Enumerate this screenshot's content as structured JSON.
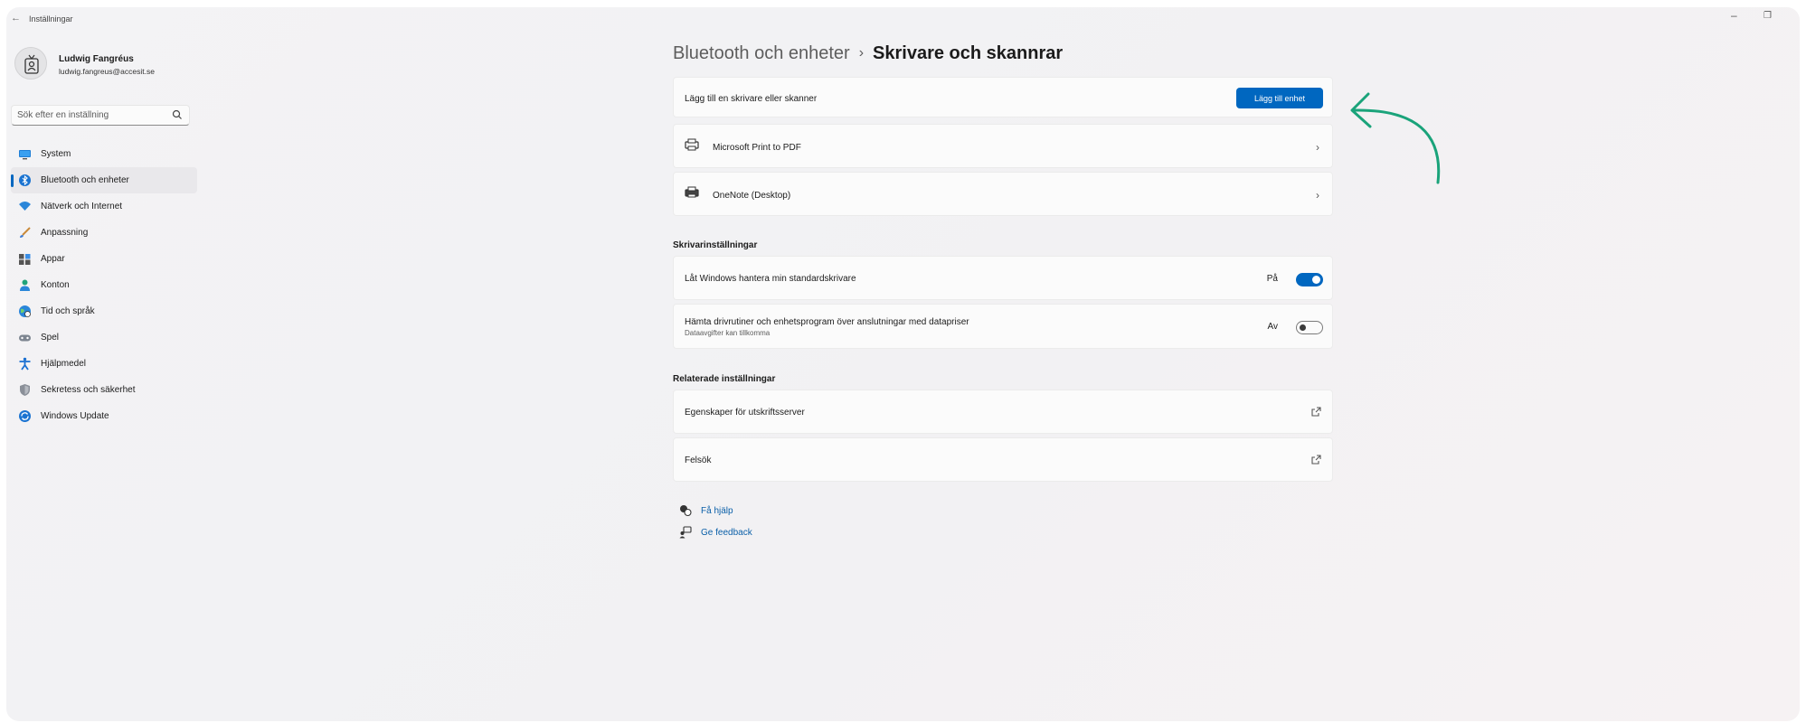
{
  "window": {
    "title": "Inställningar",
    "back_glyph": "←",
    "minimize_glyph": "–",
    "restore_glyph": "❐"
  },
  "profile": {
    "name": "Ludwig Fangréus",
    "email": "ludwig.fangreus@accesit.se"
  },
  "search": {
    "placeholder": "Sök efter en inställning"
  },
  "sidebar": {
    "items": [
      {
        "label": "System",
        "icon": "monitor-icon",
        "active": false
      },
      {
        "label": "Bluetooth och enheter",
        "icon": "bluetooth-icon",
        "active": true
      },
      {
        "label": "Nätverk och Internet",
        "icon": "wifi-icon",
        "active": false
      },
      {
        "label": "Anpassning",
        "icon": "brush-icon",
        "active": false
      },
      {
        "label": "Appar",
        "icon": "apps-icon",
        "active": false
      },
      {
        "label": "Konton",
        "icon": "person-icon",
        "active": false
      },
      {
        "label": "Tid och språk",
        "icon": "globe-clock-icon",
        "active": false
      },
      {
        "label": "Spel",
        "icon": "gamepad-icon",
        "active": false
      },
      {
        "label": "Hjälpmedel",
        "icon": "accessibility-icon",
        "active": false
      },
      {
        "label": "Sekretess och säkerhet",
        "icon": "shield-icon",
        "active": false
      },
      {
        "label": "Windows Update",
        "icon": "update-icon",
        "active": false
      }
    ]
  },
  "breadcrumb": {
    "parent": "Bluetooth och enheter",
    "separator": "›",
    "current": "Skrivare och skannrar"
  },
  "add_device": {
    "label": "Lägg till en skrivare eller skanner",
    "button": "Lägg till enhet"
  },
  "devices": [
    {
      "label": "Microsoft Print to PDF",
      "icon": "printer-icon"
    },
    {
      "label": "OneNote (Desktop)",
      "icon": "printer-icon"
    }
  ],
  "printer_settings": {
    "title": "Skrivarinställningar",
    "items": [
      {
        "label": "Låt Windows hantera min standardskrivare",
        "sub": "",
        "state": "På",
        "on": true
      },
      {
        "label": "Hämta drivrutiner och enhetsprogram över anslutningar med datapriser",
        "sub": "Dataavgifter kan tillkomma",
        "state": "Av",
        "on": false
      }
    ]
  },
  "related": {
    "title": "Relaterade inställningar",
    "items": [
      {
        "label": "Egenskaper för utskriftsserver",
        "icon": "external-link-icon"
      },
      {
        "label": "Felsök",
        "icon": "external-link-icon"
      }
    ]
  },
  "help_links": [
    {
      "label": "Få hjälp",
      "icon": "help-chat-icon"
    },
    {
      "label": "Ge feedback",
      "icon": "feedback-icon"
    }
  ],
  "colors": {
    "accent": "#0067c0",
    "annotation_arrow": "#1aa37a"
  }
}
